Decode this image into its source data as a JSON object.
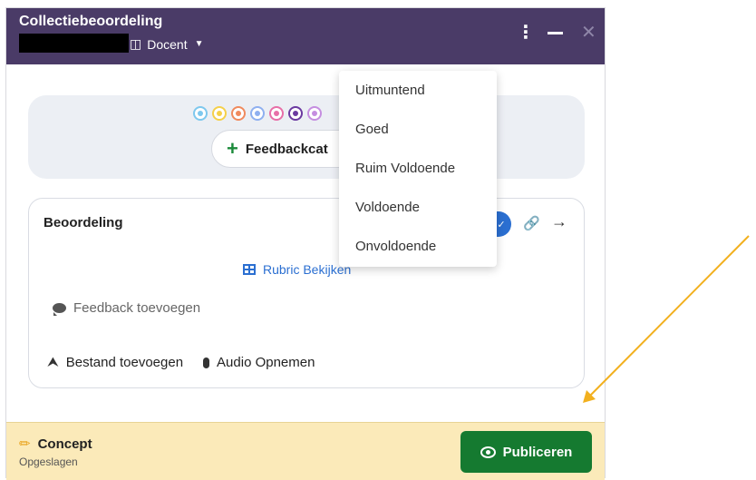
{
  "header": {
    "title": "Collectiebeoordeling",
    "role_label": "Docent",
    "more_icon": "more-vertical-icon",
    "minimize_icon": "minimize-icon",
    "close_icon": "close-icon"
  },
  "feedback_categories": {
    "button_label": "Feedbackcat",
    "dot_colors": [
      "#7ec8ee",
      "#f5d04a",
      "#f08a5d",
      "#8fb0f0",
      "#e86fa8",
      "#6b3aa0",
      "#c58ee0"
    ]
  },
  "grade_card": {
    "title": "Beoordeling",
    "rubric_label": "Rubric Bekijken",
    "feedback_label": "Feedback toevoegen",
    "file_label": "Bestand toevoegen",
    "audio_label": "Audio Opnemen"
  },
  "footer": {
    "status": "Concept",
    "saved": "Opgeslagen",
    "publish_label": "Publiceren"
  },
  "dropdown": {
    "options": [
      "Uitmuntend",
      "Goed",
      "Ruim Voldoende",
      "Voldoende",
      "Onvoldoende"
    ]
  },
  "colors": {
    "header_bg": "#4a3b67",
    "publish_bg": "#157a30",
    "footer_bg": "#fbeab9",
    "link": "#2b6fd1",
    "annotation_arrow": "#f2b01e"
  }
}
